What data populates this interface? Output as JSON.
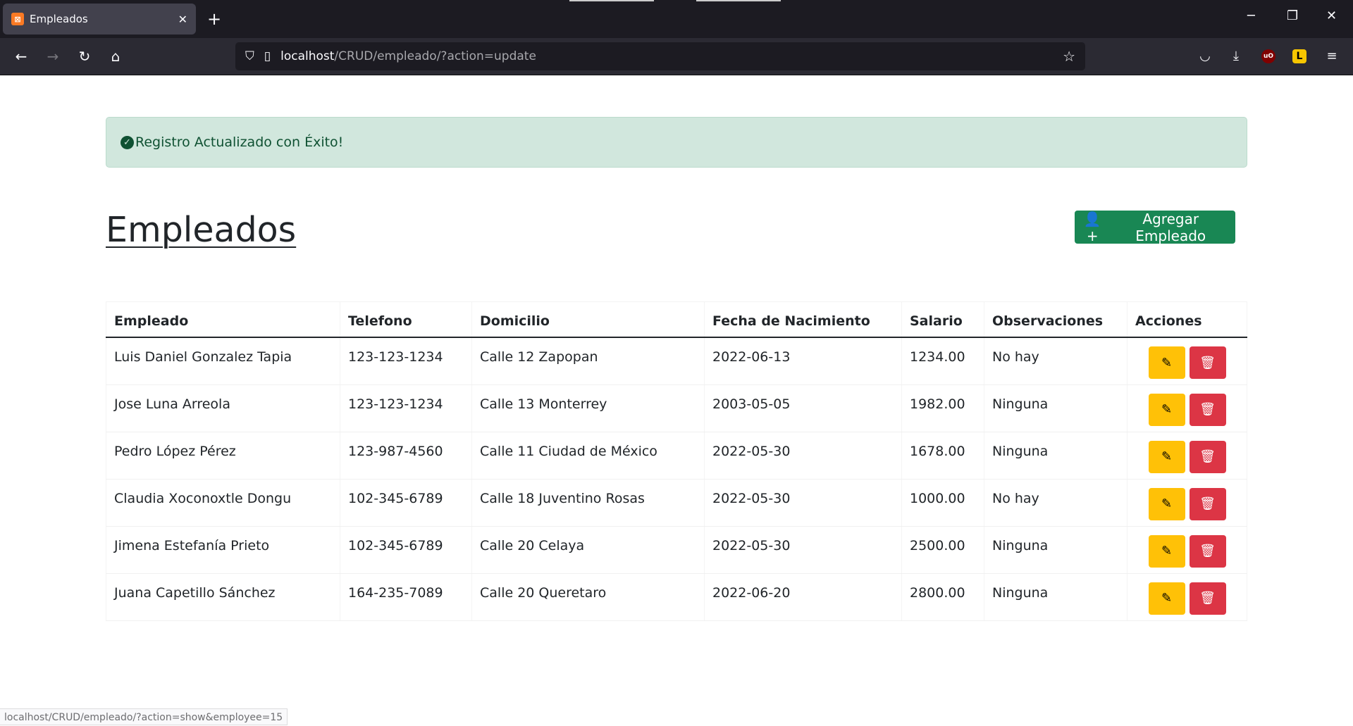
{
  "browser": {
    "tab_title": "Empleados",
    "tab_icon_glyph": "⊠",
    "url_host": "localhost",
    "url_path": "/CRUD/empleado/?action=update",
    "status_url": "localhost/CRUD/empleado/?action=show&employee=15"
  },
  "alert": {
    "message": "Registro Actualizado con Éxito!",
    "color": "#0f5132"
  },
  "page": {
    "title": "Empleados",
    "add_button_label": "Agregar Empleado"
  },
  "table": {
    "headers": [
      "Empleado",
      "Telefono",
      "Domicilio",
      "Fecha de Nacimiento",
      "Salario",
      "Observaciones",
      "Acciones"
    ],
    "rows": [
      {
        "empleado": "Luis Daniel Gonzalez Tapia",
        "telefono": "123-123-1234",
        "domicilio": "Calle 12 Zapopan",
        "fecha": "2022-06-13",
        "salario": "1234.00",
        "observaciones": "No hay"
      },
      {
        "empleado": "Jose Luna Arreola",
        "telefono": "123-123-1234",
        "domicilio": "Calle 13 Monterrey",
        "fecha": "2003-05-05",
        "salario": "1982.00",
        "observaciones": "Ninguna"
      },
      {
        "empleado": "Pedro López Pérez",
        "telefono": "123-987-4560",
        "domicilio": "Calle 11 Ciudad de México",
        "fecha": "2022-05-30",
        "salario": "1678.00",
        "observaciones": "Ninguna"
      },
      {
        "empleado": "Claudia Xoconoxtle Dongu",
        "telefono": "102-345-6789",
        "domicilio": "Calle 18 Juventino Rosas",
        "fecha": "2022-05-30",
        "salario": "1000.00",
        "observaciones": "No hay"
      },
      {
        "empleado": "Jimena Estefanía Prieto",
        "telefono": "102-345-6789",
        "domicilio": "Calle 20 Celaya",
        "fecha": "2022-05-30",
        "salario": "2500.00",
        "observaciones": "Ninguna"
      },
      {
        "empleado": "Juana Capetillo Sánchez",
        "telefono": "164-235-7089",
        "domicilio": "Calle 20 Queretaro",
        "fecha": "2022-06-20",
        "salario": "2800.00",
        "observaciones": "Ninguna"
      }
    ]
  },
  "colors": {
    "edit_button": "#ffc107",
    "delete_button": "#dc3545",
    "add_button": "#198754",
    "alert_bg": "#d1e7dd"
  },
  "icons": {
    "edit": "pencil-icon",
    "delete": "trash-icon",
    "add": "user-plus-icon",
    "alert": "check-circle-icon"
  }
}
